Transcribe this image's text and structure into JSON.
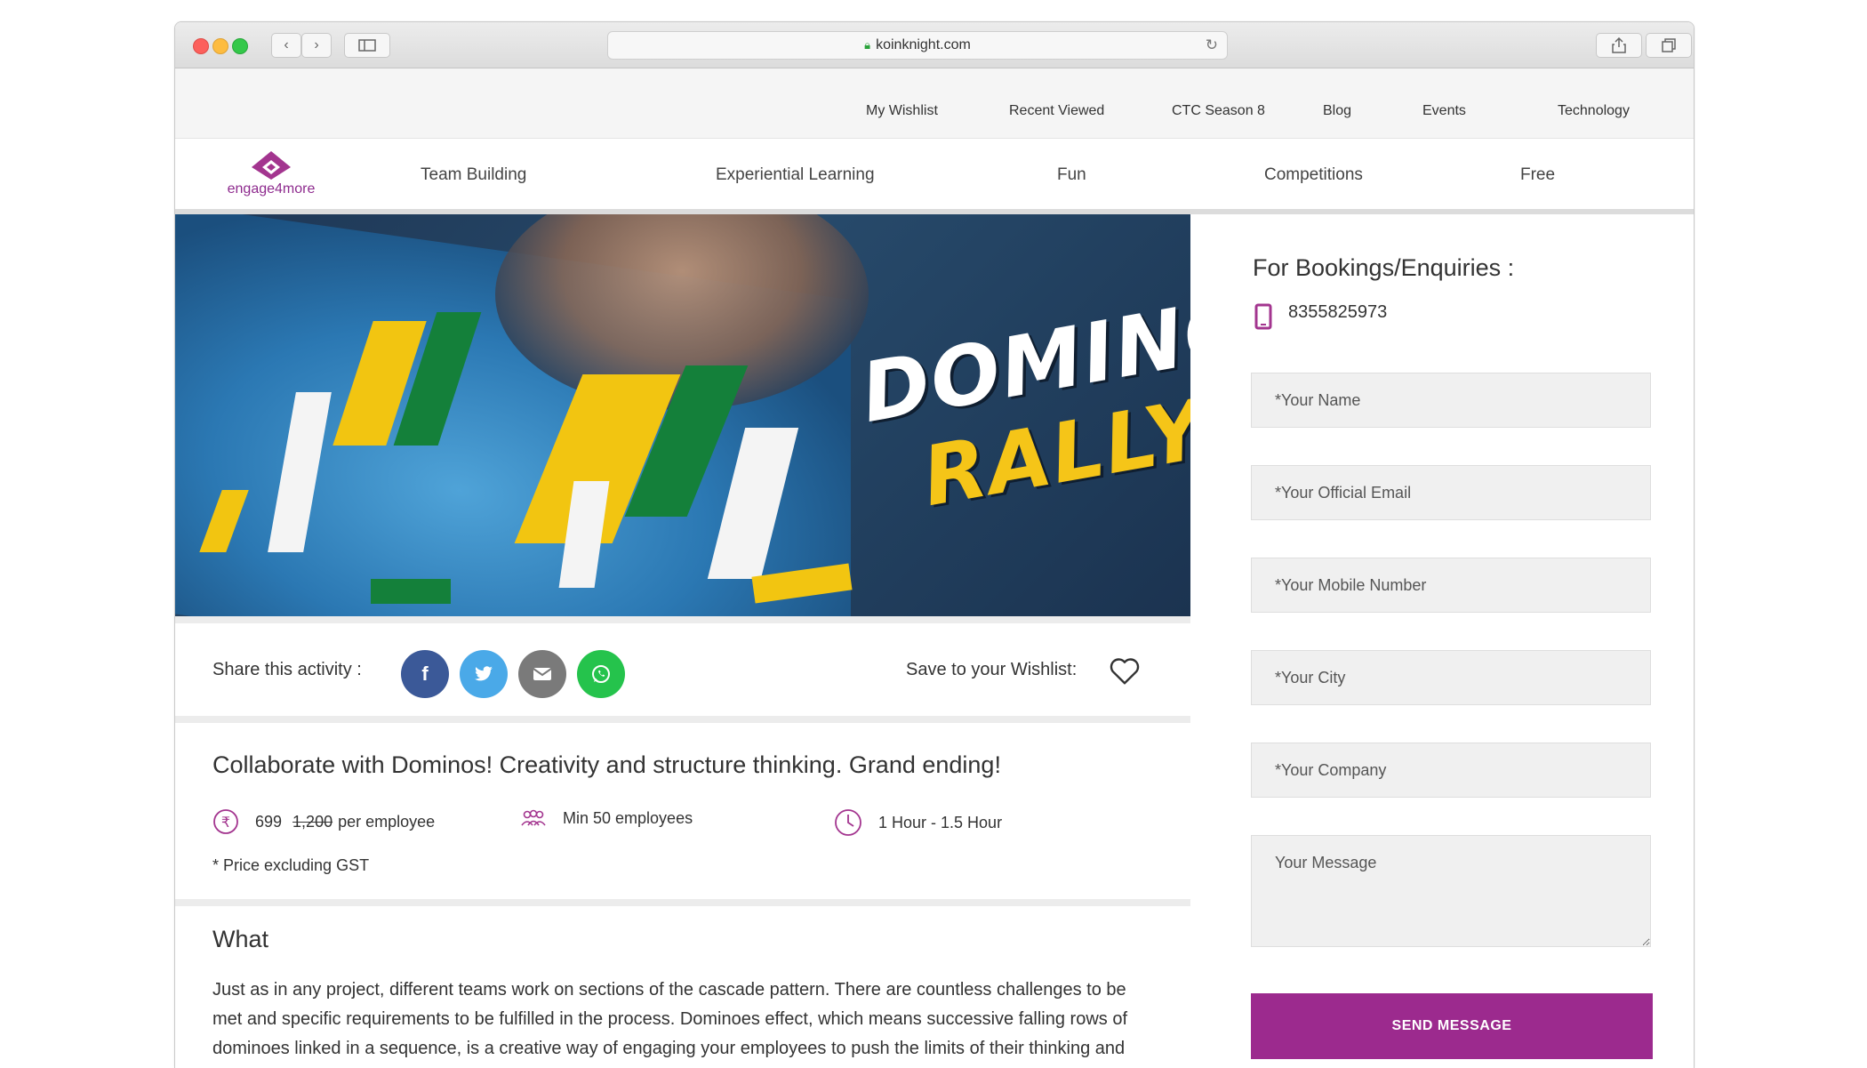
{
  "browser": {
    "url": "koinknight.com"
  },
  "top_links": [
    "My Wishlist",
    "Recent Viewed",
    "CTC Season 8",
    "Blog",
    "Events",
    "Technology"
  ],
  "logo": {
    "text": "engage4more"
  },
  "main_nav": [
    "Team Building",
    "Experiential Learning",
    "Fun",
    "Competitions",
    "Free"
  ],
  "hero": {
    "line1": "DOMINO",
    "line2": "RALLY"
  },
  "share": {
    "label": "Share this activity :",
    "wishlist_label": "Save to your Wishlist:",
    "buttons": [
      {
        "icon": "facebook-icon",
        "glyph": "f",
        "color": "#3b5998"
      },
      {
        "icon": "twitter-icon",
        "glyph": "t",
        "color": "#4aa9e8"
      },
      {
        "icon": "email-icon",
        "glyph": "✉",
        "color": "#7a7a7a"
      },
      {
        "icon": "whatsapp-icon",
        "glyph": "w",
        "color": "#25c34c"
      }
    ]
  },
  "activity": {
    "headline": "Collaborate with Dominos! Creativity and structure thinking. Grand ending!",
    "price": "699",
    "old_price": "1,200",
    "price_unit": "per employee",
    "min_size": "Min 50 employees",
    "duration": "1 Hour - 1.5 Hour",
    "note": "* Price excluding GST"
  },
  "what": {
    "heading": "What",
    "body": "Just as in any project, different teams work on sections of the cascade pattern. There are countless challenges to be met and specific requirements to be fulfilled in the process. Dominoes effect, which means successive falling rows of dominoes linked in a sequence, is a creative way of engaging your employees to push the limits of their thinking and align focus. You can almost feel the tension and the enthusiasm as the"
  },
  "booking": {
    "heading": "For Bookings/Enquiries :",
    "phone": "8355825973",
    "fields": {
      "name": "*Your Name",
      "email": "*Your Official Email",
      "mobile": "*Your Mobile Number",
      "city": "*Your City",
      "company": "*Your Company",
      "message": "Your Message"
    },
    "submit": "SEND MESSAGE"
  },
  "colors": {
    "brand": "#9c2a8e",
    "accent_icon": "#a3358f"
  }
}
